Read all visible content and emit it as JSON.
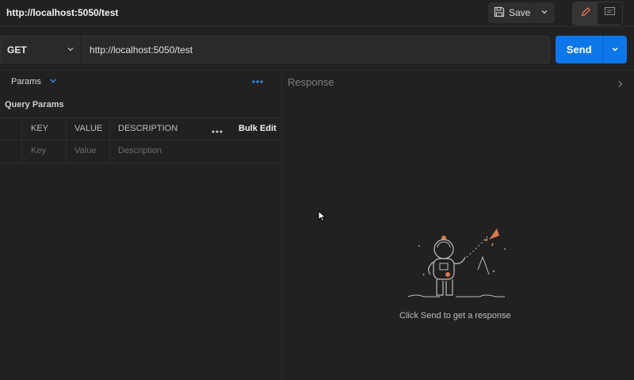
{
  "header": {
    "title": "http://localhost:5050/test",
    "save_label": "Save"
  },
  "request": {
    "method": "GET",
    "url": "http://localhost:5050/test",
    "send_label": "Send"
  },
  "params_panel": {
    "tab_label": "Params",
    "section_title": "Query Params",
    "columns": [
      "KEY",
      "VALUE",
      "DESCRIPTION"
    ],
    "bulk_edit_label": "Bulk Edit",
    "placeholders": {
      "key": "Key",
      "value": "Value",
      "description": "Description"
    }
  },
  "response_panel": {
    "title": "Response",
    "empty_message": "Click Send to get a response"
  },
  "colors": {
    "background": "#212121",
    "accent_blue": "#0d76e8",
    "pencil_accent": "#e8704f",
    "rocket_accent": "#d97a3a"
  },
  "icons": [
    "save-icon",
    "chevron-down-icon",
    "pencil-icon",
    "comment-icon",
    "more-icon",
    "chevron-right-icon",
    "astronaut-illustration"
  ]
}
